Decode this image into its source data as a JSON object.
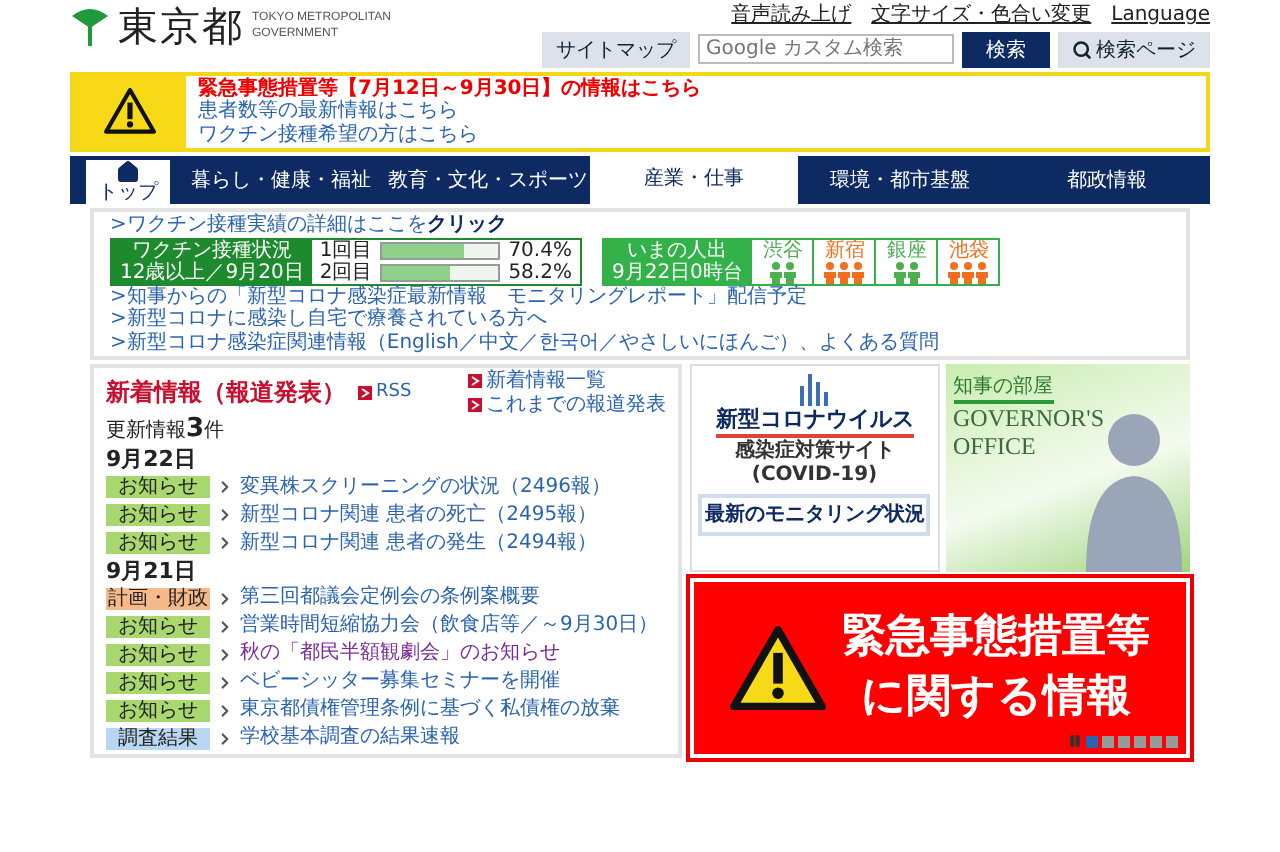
{
  "header": {
    "logo": "東京都",
    "logo_sub": [
      "TOKYO METROPOLITAN",
      "GOVERNMENT"
    ],
    "links": [
      "音声読み上げ",
      "文字サイズ・色合い変更",
      "Language"
    ],
    "sitemap": "サイトマップ",
    "search": {
      "placeholder": "Google カスタム検索"
    },
    "search_button": "検索",
    "search_page": "検索ページ"
  },
  "alert": {
    "headline": "緊急事態措置等【7月12日～9月30日】の情報はこちら",
    "links": [
      "患者数等の最新情報はこちら",
      "ワクチン接種希望の方はこちら"
    ]
  },
  "nav": {
    "home": "トップ",
    "tabs": [
      {
        "label": "暮らし・健康・福祉",
        "selected": false
      },
      {
        "label": "教育・文化・スポーツ",
        "selected": false
      },
      {
        "label": "産業・仕事",
        "selected": true
      },
      {
        "label": "環境・都市基盤",
        "selected": false
      },
      {
        "label": "都政情報",
        "selected": false
      }
    ]
  },
  "info": {
    "vaccine_link": ">ワクチン接種実績の詳細はここを**クリック**",
    "vaccine": {
      "title": "ワクチン接種状況",
      "subtitle": "12歳以上／9月20日",
      "doses": [
        {
          "label": "1回目",
          "level": 0.704,
          "reading": "70.4%"
        },
        {
          "label": "2回目",
          "level": 0.582,
          "reading": "58.2%"
        }
      ]
    },
    "crowd": {
      "title": "いまの人出",
      "time": "9月22日0時台",
      "areas": [
        {
          "name": "渋谷",
          "kind": "calm"
        },
        {
          "name": "新宿",
          "kind": "busy"
        },
        {
          "name": "銀座",
          "kind": "calm"
        },
        {
          "name": "池袋",
          "kind": "busy"
        }
      ]
    },
    "links": [
      ">知事からの「新型コロナ感染症最新情報　モニタリングレポート」配信予定",
      ">新型コロナに感染し自宅で療養されている方へ",
      ">新型コロナ感染症関連情報（English／中文／한국어／やさしいにほんご）、よくある質問"
    ]
  },
  "news": {
    "title": "新着情報（報道発表）",
    "rss": "RSS",
    "side_links": [
      "新着情報一覧",
      "これまでの報道発表"
    ],
    "count": "更新情報**3**件",
    "groups": [
      {
        "date": "9月22日",
        "items": [
          {
            "tag": "お知らせ",
            "kind": "notice",
            "text": "変異株スクリーニングの状況（2496報）",
            "visited": false
          },
          {
            "tag": "お知らせ",
            "kind": "notice",
            "text": "新型コロナ関連 患者の死亡（2495報）",
            "visited": false
          },
          {
            "tag": "お知らせ",
            "kind": "notice",
            "text": "新型コロナ関連 患者の発生（2494報）",
            "visited": false
          }
        ]
      },
      {
        "date": "9月21日",
        "items": [
          {
            "tag": "計画・財政",
            "kind": "plan",
            "text": "第三回都議会定例会の条例案概要",
            "visited": false
          },
          {
            "tag": "お知らせ",
            "kind": "notice",
            "text": "営業時間短縮協力会（飲食店等／～9月30日）",
            "visited": false
          },
          {
            "tag": "お知らせ",
            "kind": "notice",
            "text": "秋の「都民半額観劇会」のお知らせ",
            "visited": true
          },
          {
            "tag": "お知らせ",
            "kind": "notice",
            "text": "ベビーシッター募集セミナーを開催",
            "visited": false
          },
          {
            "tag": "お知らせ",
            "kind": "notice",
            "text": "東京都債権管理条例に基づく私債権の放棄",
            "visited": false
          },
          {
            "tag": "調査結果",
            "kind": "survey",
            "text": "学校基本調査の結果速報",
            "visited": false
          }
        ]
      }
    ]
  },
  "banners": {
    "covid": {
      "title": "新型コロナウイルス",
      "subtitle": "感染症対策サイト",
      "note": "(COVID-19)",
      "button": "最新のモニタリング状況"
    },
    "governor": {
      "label": "知事の部屋",
      "title": [
        "GOVERNOR'S",
        "OFFICE"
      ]
    },
    "emergency": {
      "lines": [
        "緊急事態措置等",
        "に関する情報"
      ]
    },
    "dots": [
      {
        "selected": true
      },
      {
        "selected": false
      },
      {
        "selected": false
      },
      {
        "selected": false
      },
      {
        "selected": false
      },
      {
        "selected": false
      }
    ]
  }
}
